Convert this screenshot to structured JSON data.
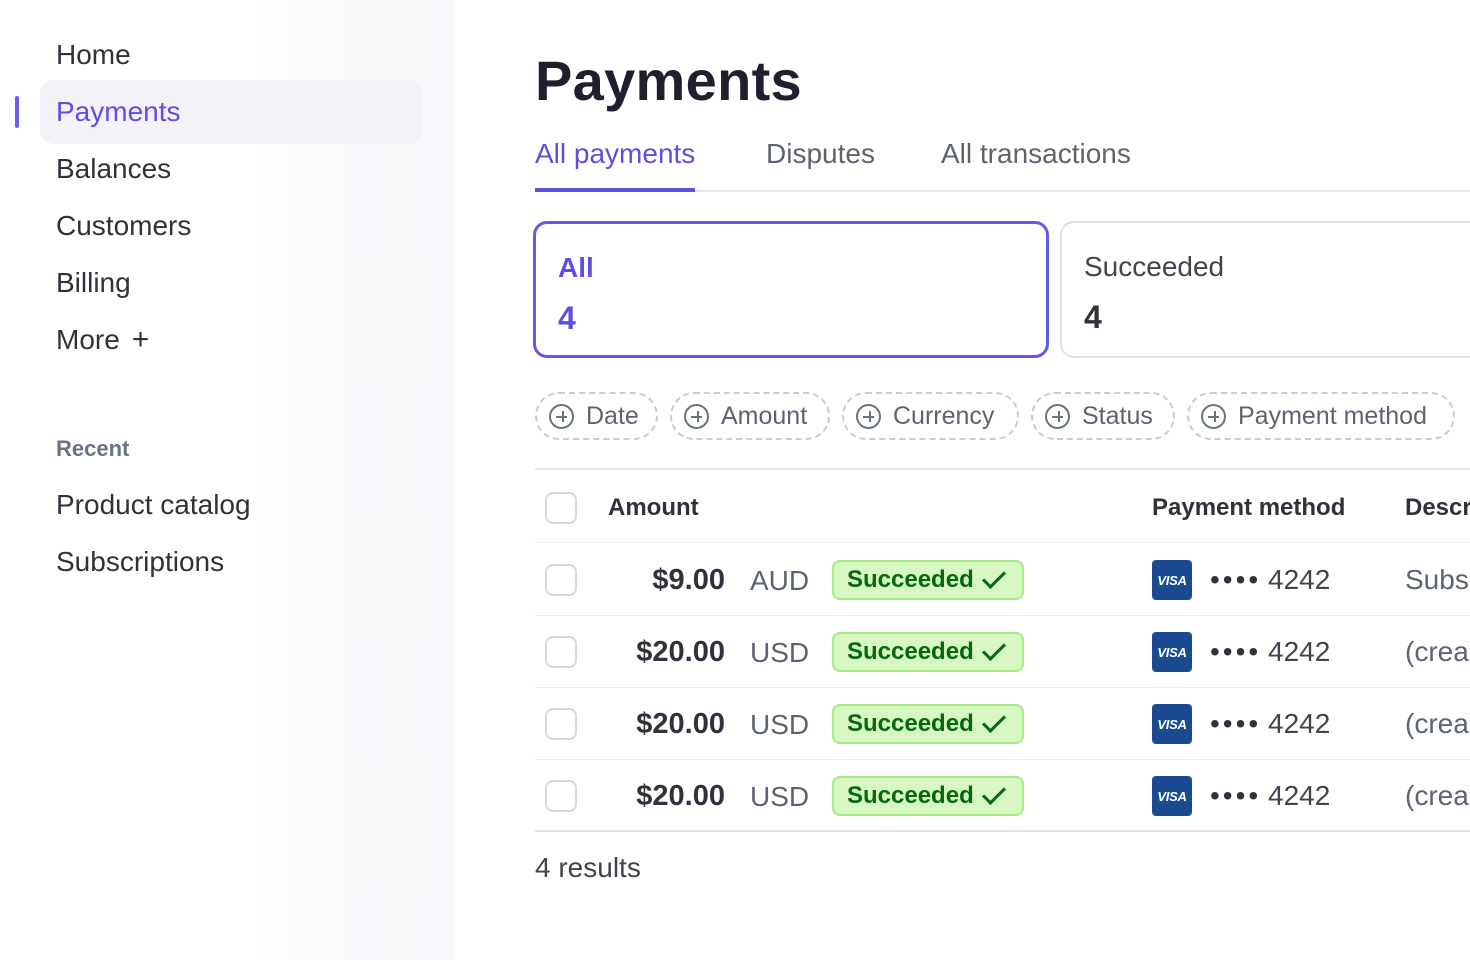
{
  "sidebar": {
    "items": [
      {
        "label": "Home"
      },
      {
        "label": "Payments"
      },
      {
        "label": "Balances"
      },
      {
        "label": "Customers"
      },
      {
        "label": "Billing"
      },
      {
        "label": "More",
        "suffix": "+"
      }
    ],
    "active_item": "Payments",
    "recent_title": "Recent",
    "recent_items": [
      {
        "label": "Product catalog"
      },
      {
        "label": "Subscriptions"
      }
    ]
  },
  "main": {
    "title": "Payments",
    "tabs": [
      {
        "label": "All payments",
        "active": true
      },
      {
        "label": "Disputes"
      },
      {
        "label": "All transactions"
      }
    ],
    "summary_cards": [
      {
        "label": "All",
        "count": "4",
        "selected": true
      },
      {
        "label": "Succeeded",
        "count": "4"
      }
    ],
    "filters": [
      {
        "label": "Date",
        "icon": "plus-circle-icon"
      },
      {
        "label": "Amount",
        "icon": "plus-circle-icon"
      },
      {
        "label": "Currency",
        "icon": "plus-circle-icon"
      },
      {
        "label": "Status",
        "icon": "plus-circle-icon"
      },
      {
        "label": "Payment method",
        "icon": "plus-circle-icon"
      }
    ],
    "table": {
      "headers": {
        "amount": "Amount",
        "payment_method": "Payment method",
        "description": "Descr"
      },
      "rows": [
        {
          "amount": "$9.00",
          "currency": "AUD",
          "status": "Succeeded",
          "card_brand": "VISA",
          "dots": "••••",
          "last4": "4242",
          "description": "Subs"
        },
        {
          "amount": "$20.00",
          "currency": "USD",
          "status": "Succeeded",
          "card_brand": "VISA",
          "dots": "••••",
          "last4": "4242",
          "description": "(crea"
        },
        {
          "amount": "$20.00",
          "currency": "USD",
          "status": "Succeeded",
          "card_brand": "VISA",
          "dots": "••••",
          "last4": "4242",
          "description": "(crea"
        },
        {
          "amount": "$20.00",
          "currency": "USD",
          "status": "Succeeded",
          "card_brand": "VISA",
          "dots": "••••",
          "last4": "4242",
          "description": "(crea"
        }
      ]
    },
    "results_text": "4 results"
  },
  "colors": {
    "accent": "#5d4fe0",
    "success_bg": "#d7f7c2",
    "success_text": "#05690d",
    "visa_blue": "#1a4a8f"
  }
}
